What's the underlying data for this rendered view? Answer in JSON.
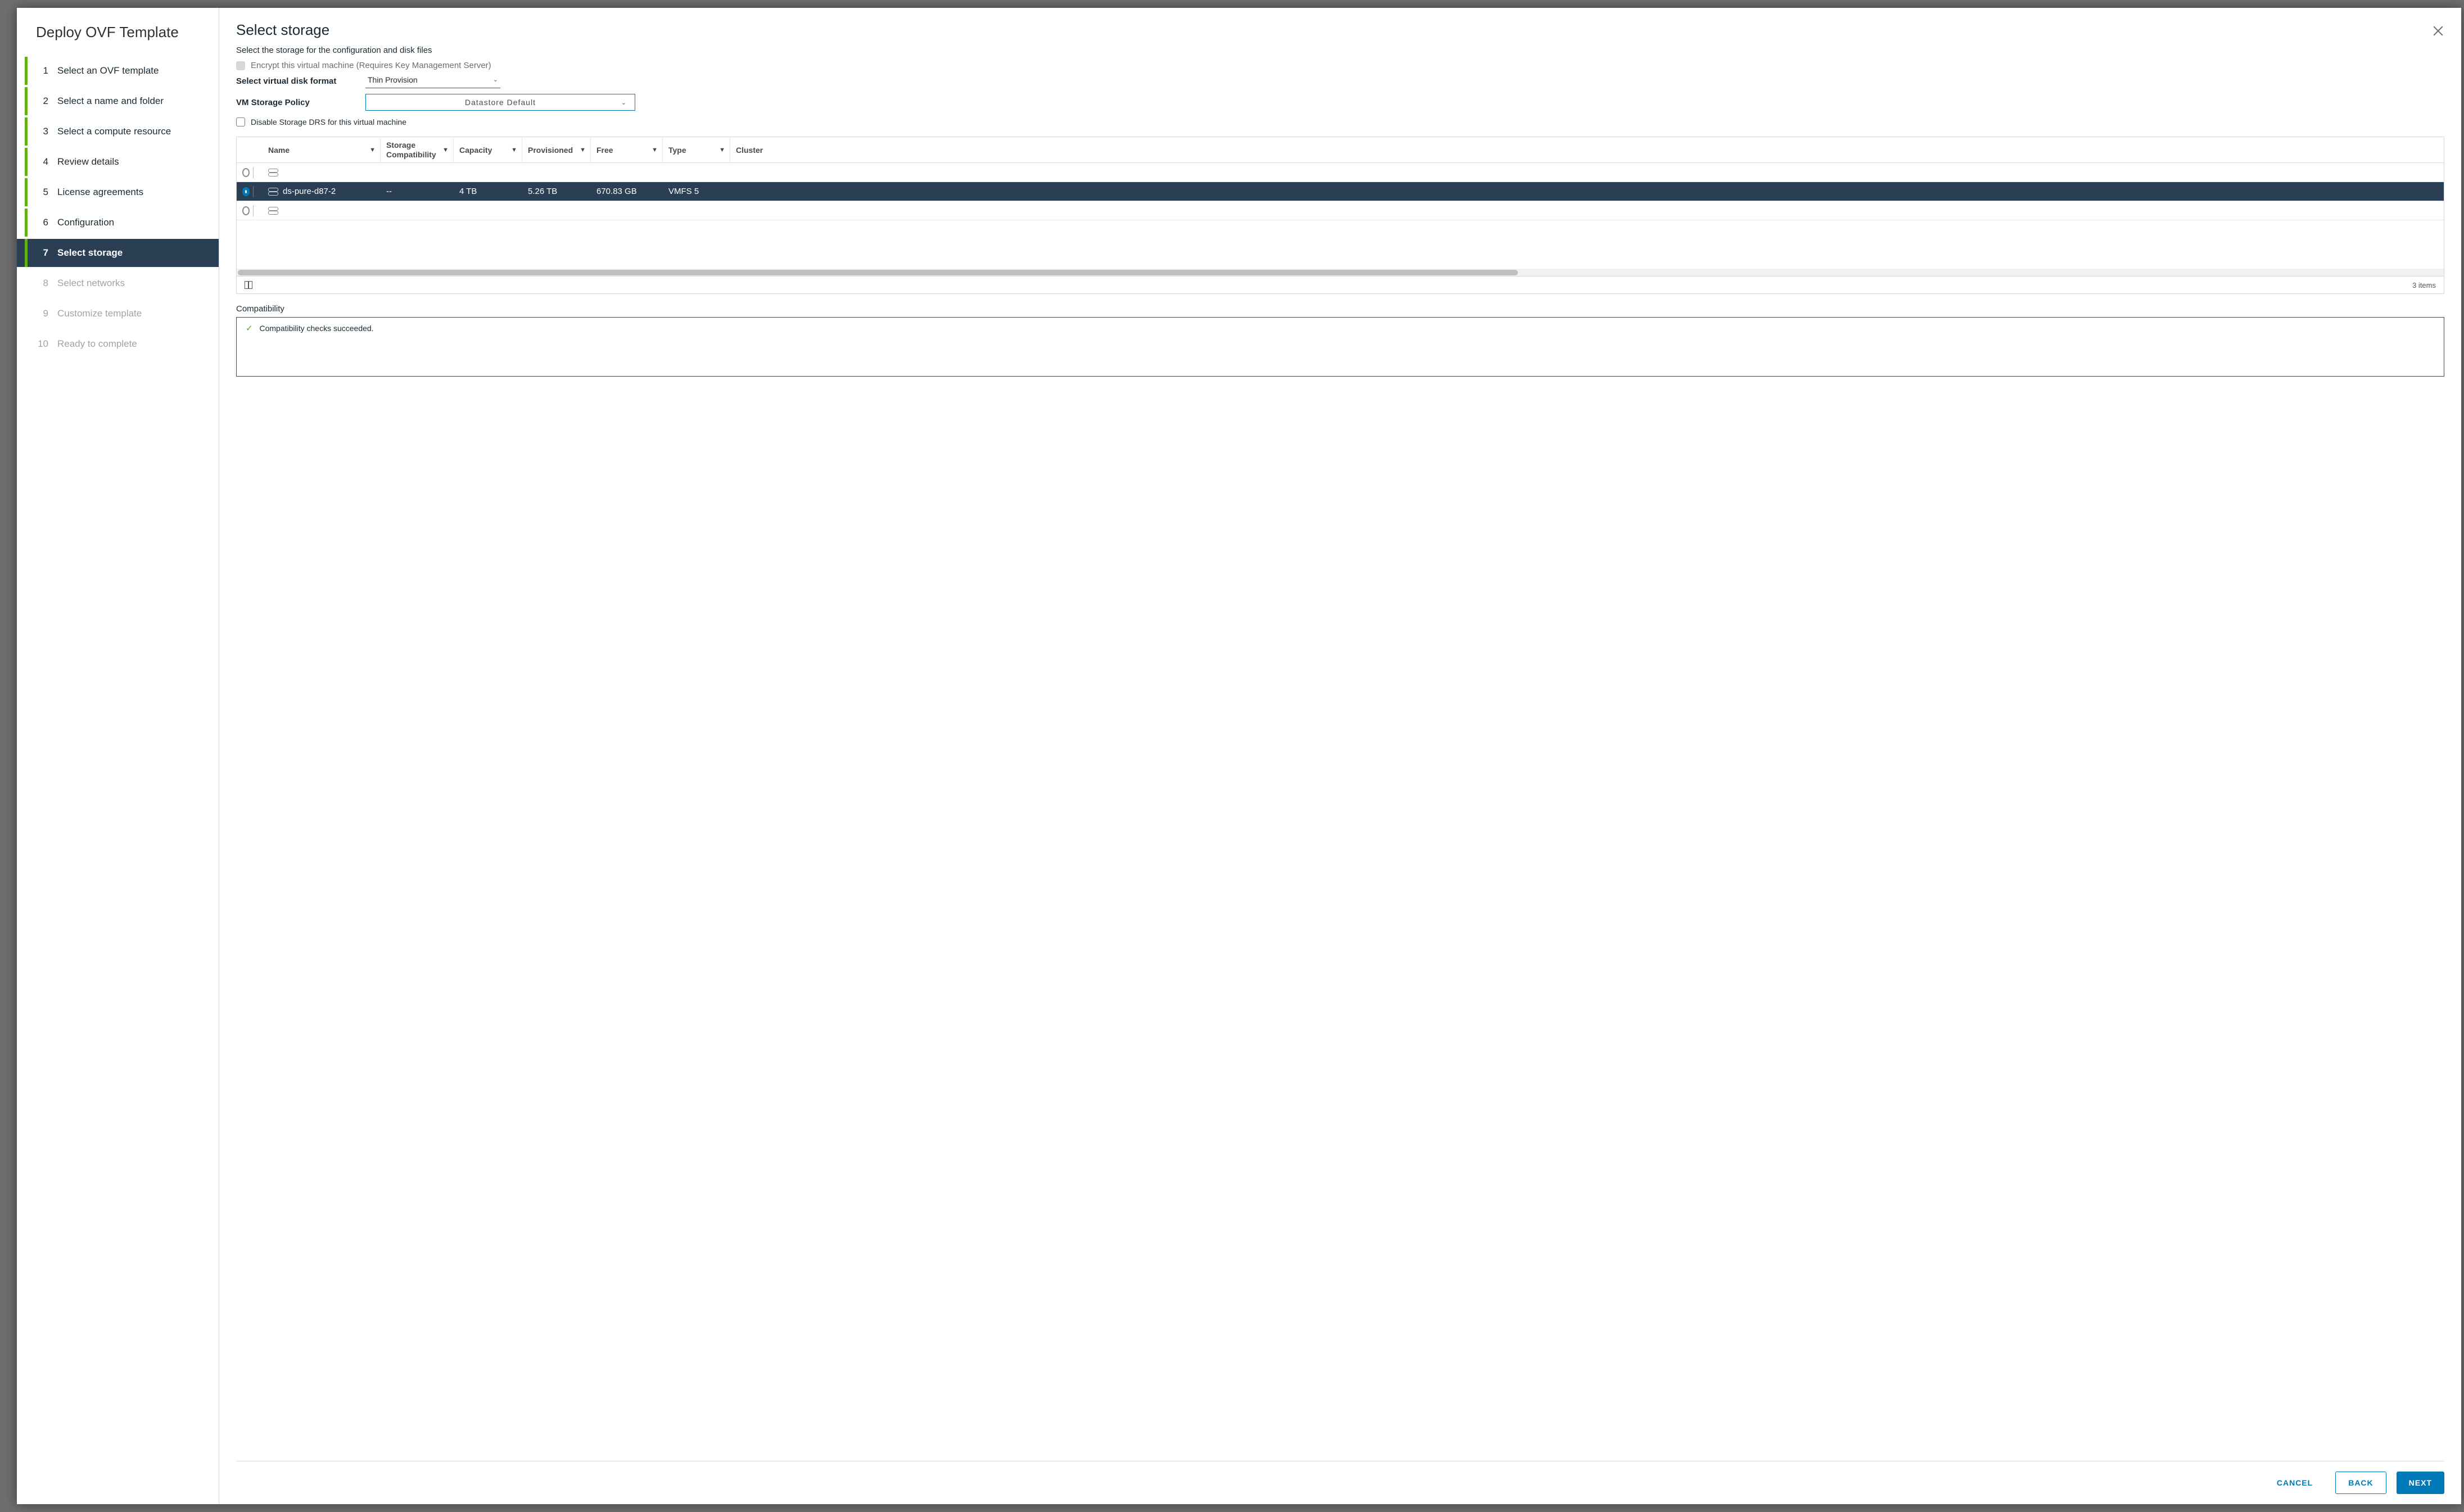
{
  "wizard": {
    "title": "Deploy OVF Template",
    "steps": [
      {
        "num": "1",
        "label": "Select an OVF template",
        "state": "done"
      },
      {
        "num": "2",
        "label": "Select a name and folder",
        "state": "done"
      },
      {
        "num": "3",
        "label": "Select a compute resource",
        "state": "done"
      },
      {
        "num": "4",
        "label": "Review details",
        "state": "done"
      },
      {
        "num": "5",
        "label": "License agreements",
        "state": "done"
      },
      {
        "num": "6",
        "label": "Configuration",
        "state": "done"
      },
      {
        "num": "7",
        "label": "Select storage",
        "state": "current"
      },
      {
        "num": "8",
        "label": "Select networks",
        "state": "future"
      },
      {
        "num": "9",
        "label": "Customize template",
        "state": "future"
      },
      {
        "num": "10",
        "label": "Ready to complete",
        "state": "future"
      }
    ]
  },
  "page": {
    "title": "Select storage",
    "subtitle": "Select the storage for the configuration and disk files",
    "encrypt_label": "Encrypt this virtual machine (Requires Key Management Server)",
    "vdisk_label": "Select virtual disk format",
    "vdisk_value": "Thin Provision",
    "policy_label": "VM Storage Policy",
    "policy_value": "Datastore Default",
    "disable_drs_label": "Disable Storage DRS for this virtual machine"
  },
  "table": {
    "headers": {
      "name": "Name",
      "storage_compat": "Storage Compatibility",
      "capacity": "Capacity",
      "provisioned": "Provisioned",
      "free": "Free",
      "type": "Type",
      "cluster": "Cluster"
    },
    "rows": [
      {
        "selected": false,
        "name": "",
        "storage_compat": "",
        "capacity": "",
        "provisioned": "",
        "free": "",
        "type": ""
      },
      {
        "selected": true,
        "name": "ds-pure-d87-2",
        "storage_compat": "--",
        "capacity": "4 TB",
        "provisioned": "5.26 TB",
        "free": "670.83 GB",
        "type": "VMFS 5"
      },
      {
        "selected": false,
        "name": "",
        "storage_compat": "",
        "capacity": "",
        "provisioned": "",
        "free": "",
        "type": ""
      }
    ],
    "footer_count": "3 items"
  },
  "compat": {
    "label": "Compatibility",
    "message": "Compatibility checks succeeded."
  },
  "footer": {
    "cancel": "CANCEL",
    "back": "BACK",
    "next": "NEXT"
  }
}
